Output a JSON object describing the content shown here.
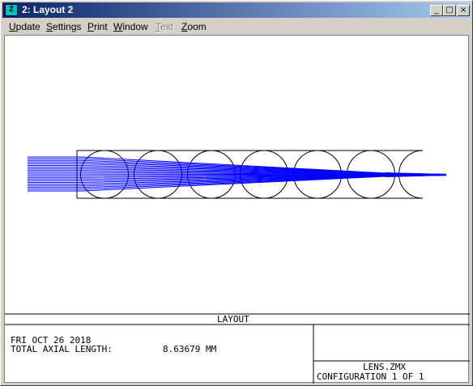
{
  "window": {
    "icon_label": "Z",
    "title": "2: Layout 2",
    "minimize_glyph": "_",
    "maximize_glyph": "□",
    "close_glyph": "×"
  },
  "menu": [
    {
      "first": "U",
      "rest": "pdate",
      "enabled": true
    },
    {
      "first": "S",
      "rest": "ettings",
      "enabled": true
    },
    {
      "first": "P",
      "rest": "rint",
      "enabled": true
    },
    {
      "first": "W",
      "rest": "indow",
      "enabled": true
    },
    {
      "first": "T",
      "rest": "ext",
      "enabled": false
    },
    {
      "first": "Z",
      "rest": "oom",
      "enabled": true
    }
  ],
  "plot": {
    "title": "LAYOUT",
    "date_line": "FRI OCT 26 2018",
    "length_label": "TOTAL AXIAL LENGTH:",
    "length_value": "8.63679 MM",
    "file_name": "LENS.ZMX",
    "configuration": "CONFIGURATION 1 OF 1",
    "ray_color": "#0000ff",
    "outline_color": "#000000"
  }
}
